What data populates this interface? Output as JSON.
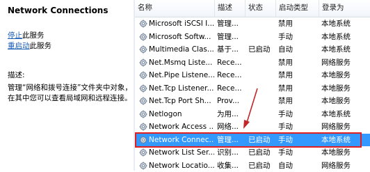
{
  "left": {
    "title": "Network Connections",
    "stop": {
      "link": "停止",
      "suffix": "此服务"
    },
    "restart": {
      "link": "重启动",
      "suffix": "此服务"
    },
    "description_label": "描述:",
    "description_text": "管理“网络和拨号连接”文件夹中对象，在其中您可以查看局域网和远程连接。"
  },
  "columns": [
    "名称",
    "描述",
    "状态",
    "启动类型",
    "登录为"
  ],
  "services": [
    {
      "name": "Microsoft iSCSI I...",
      "desc": "管理...",
      "status": "",
      "startup": "禁用",
      "logon": "本地系统"
    },
    {
      "name": "Microsoft Softw...",
      "desc": "管理...",
      "status": "",
      "startup": "手动",
      "logon": "本地系统"
    },
    {
      "name": "Multimedia Clas...",
      "desc": "基于...",
      "status": "已启动",
      "startup": "自动",
      "logon": "本地系统"
    },
    {
      "name": "Net.Msmq Liste...",
      "desc": "Rece...",
      "status": "",
      "startup": "禁用",
      "logon": "网络服务"
    },
    {
      "name": "Net.Pipe Listene...",
      "desc": "Rece...",
      "status": "",
      "startup": "禁用",
      "logon": "本地服务"
    },
    {
      "name": "Net.Tcp Listener...",
      "desc": "Rece...",
      "status": "",
      "startup": "禁用",
      "logon": "本地服务"
    },
    {
      "name": "Net.Tcp Port Sh...",
      "desc": "Prov...",
      "status": "",
      "startup": "禁用",
      "logon": "本地服务"
    },
    {
      "name": "Netlogon",
      "desc": "为用...",
      "status": "",
      "startup": "手动",
      "logon": "本地系统"
    },
    {
      "name": "Network Access ...",
      "desc": "网络...",
      "status": "",
      "startup": "手动",
      "logon": "网络服务"
    },
    {
      "name": "Network Connec...",
      "desc": "管理...",
      "status": "已启动",
      "startup": "手动",
      "logon": "本地系统"
    },
    {
      "name": "Network List Ser...",
      "desc": "识别...",
      "status": "已启动",
      "startup": "手动",
      "logon": "本地服务"
    },
    {
      "name": "Network Locatio...",
      "desc": "收集...",
      "status": "已启动",
      "startup": "自动",
      "logon": "网络服务"
    }
  ],
  "selected_index": 9,
  "colors": {
    "selection": "#3399ff",
    "highlight_box": "#e02020",
    "link": "#1a5db6"
  }
}
